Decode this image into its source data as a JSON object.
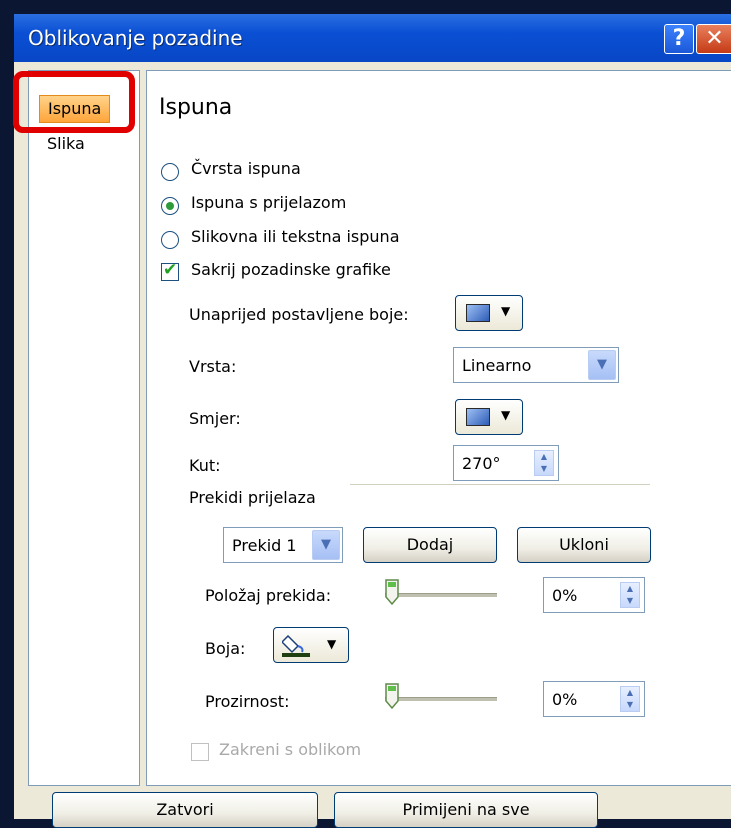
{
  "window": {
    "title": "Oblikovanje pozadine",
    "help_icon": "question-mark-icon",
    "close_icon": "close-x-icon"
  },
  "sidebar": {
    "items": [
      {
        "label": "Ispuna",
        "selected": true
      },
      {
        "label": "Slika",
        "selected": false
      }
    ]
  },
  "fill": {
    "heading": "Ispuna",
    "options": [
      {
        "label": "Čvrsta ispuna",
        "selected": false
      },
      {
        "label": "Ispuna s prijelazom",
        "selected": true
      },
      {
        "label": "Slikovna ili tekstna ispuna",
        "selected": false
      }
    ],
    "hide_background_graphics": {
      "label": "Sakrij pozadinske grafike",
      "checked": true
    },
    "preset_colors": {
      "label": "Unaprijed postavljene boje:"
    },
    "type": {
      "label": "Vrsta:",
      "value": "Linearno"
    },
    "direction": {
      "label": "Smjer:"
    },
    "angle": {
      "label": "Kut:",
      "value": "270°"
    },
    "gradient_stops": {
      "group_label": "Prekidi prijelaza",
      "selected_stop": "Prekid 1",
      "add_label": "Dodaj",
      "remove_label": "Ukloni",
      "position": {
        "label": "Položaj prekida:",
        "value": "0%",
        "fraction": 0
      },
      "color": {
        "label": "Boja:",
        "icon": "paint-bucket-icon"
      },
      "transparency": {
        "label": "Prozirnost:",
        "value": "0%",
        "fraction": 0
      }
    },
    "rotate_with_shape": {
      "label": "Zakreni s oblikom",
      "checked": false,
      "disabled": true
    }
  },
  "footer": {
    "close_label": "Zatvori",
    "apply_all_label": "Primijeni na sve"
  },
  "colors": {
    "accent": "#0a4fd4",
    "selected_tab": "#ffa53a",
    "highlight": "#e00000",
    "radio_dot": "#2f9a3a"
  }
}
